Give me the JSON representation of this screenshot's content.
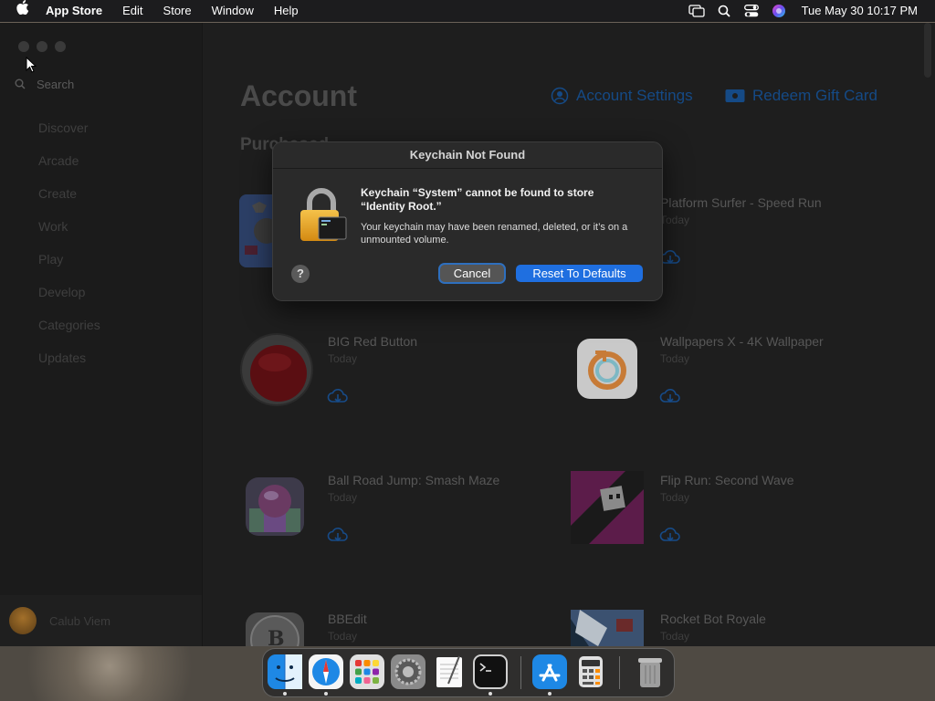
{
  "menubar": {
    "app_name": "App Store",
    "menus": [
      "Edit",
      "Store",
      "Window",
      "Help"
    ],
    "status_icons": [
      "display-mirror-icon",
      "spotlight-search-icon",
      "control-center-icon",
      "siri-icon"
    ],
    "clock": "Tue May 30  10:17 PM"
  },
  "sidebar": {
    "search_placeholder": "Search",
    "items": [
      "Discover",
      "Arcade",
      "Create",
      "Work",
      "Play",
      "Develop",
      "Categories",
      "Updates"
    ],
    "user_name": "Calub Viem"
  },
  "account": {
    "title": "Account",
    "settings_link": "Account Settings",
    "redeem_link": "Redeem Gift Card",
    "section": "Purchased",
    "apps": [
      {
        "name": "",
        "date": "",
        "icon": "sports-app-icon"
      },
      {
        "name": "Platform Surfer - Speed Run",
        "date": "Today",
        "icon": "platform-surfer-icon"
      },
      {
        "name": "BIG Red Button",
        "date": "Today",
        "icon": "big-red-button-icon"
      },
      {
        "name": "Wallpapers X - 4K Wallpaper",
        "date": "Today",
        "icon": "wallpapers-x-icon"
      },
      {
        "name": "Ball Road Jump: Smash Maze",
        "date": "Today",
        "icon": "ball-road-jump-icon"
      },
      {
        "name": "Flip Run: Second Wave",
        "date": "Today",
        "icon": "flip-run-icon"
      },
      {
        "name": "BBEdit",
        "date": "Today",
        "icon": "bbedit-icon"
      },
      {
        "name": "Rocket Bot Royale",
        "date": "Today",
        "icon": "rocket-bot-royale-icon"
      }
    ]
  },
  "dialog": {
    "title": "Keychain Not Found",
    "message_title": "Keychain “System” cannot be found to store “Identity Root.”",
    "message_body": "Your keychain may have been renamed, deleted, or it’s on a unmounted volume.",
    "help_label": "?",
    "cancel_label": "Cancel",
    "reset_label": "Reset To Defaults"
  },
  "dock": {
    "apps": [
      "Finder",
      "Safari",
      "Launchpad",
      "System Settings",
      "TextEdit",
      "Terminal",
      "App Store",
      "Calculator",
      "Trash"
    ]
  },
  "colors": {
    "accent": "#1f6fe0",
    "link": "#154a86",
    "window_bg": "#1e1e1e",
    "sidebar_bg": "#1b1b1b"
  }
}
